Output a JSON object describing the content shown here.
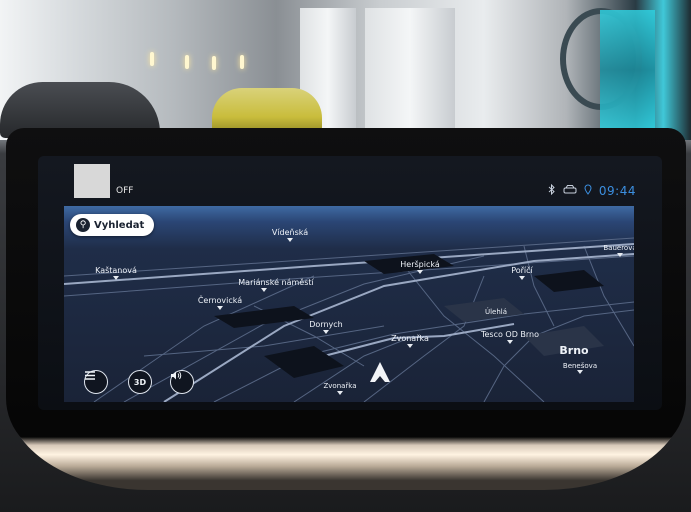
{
  "status_bar": {
    "widget_state": "OFF",
    "time": "09:44",
    "icons": [
      "bluetooth-icon",
      "car-icon",
      "location-pin-icon"
    ]
  },
  "map": {
    "search_label": "Vyhledat",
    "view_mode_label": "3D",
    "labels": {
      "videnska": "Vídeňská",
      "kastanova": "Kaštanová",
      "marianske": "Mariánské náměstí",
      "hrerspicka": "Heršpická",
      "poric": "Poříčí",
      "bauerova": "Bauerova",
      "cernovicka": "Černovická",
      "dornych": "Dornych",
      "zvonarka": "Zvonařka",
      "zvonarka2": "Zvonařka",
      "ulehla": "Úlehlá",
      "tesco": "Tesco OD Brno",
      "brno": "Brno",
      "benesova": "Benešova"
    },
    "icons": [
      "search-icon",
      "menu-icon",
      "volume-icon",
      "navigation-arrow-icon"
    ],
    "colors": {
      "map_bg": "#1a2337",
      "sky": "#3f6aa3",
      "clock": "#3c8fe0"
    }
  }
}
